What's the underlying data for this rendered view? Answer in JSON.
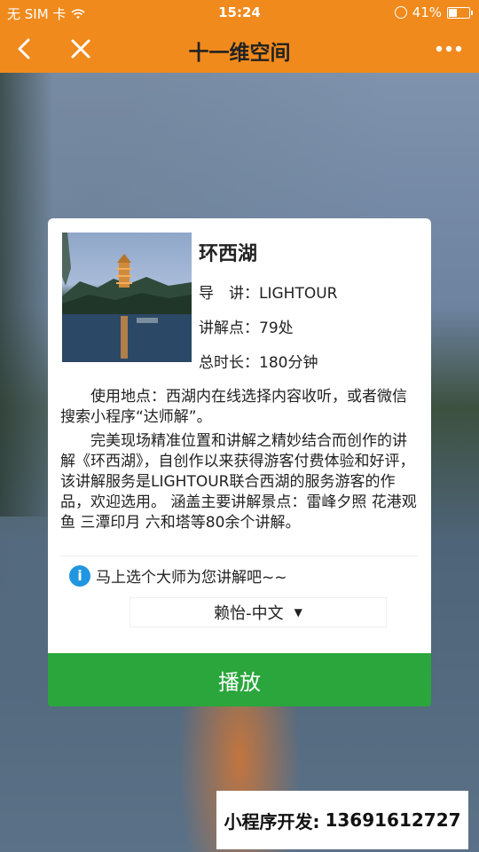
{
  "status_bar": {
    "carrier": "无 SIM 卡",
    "time": "15:24",
    "battery": "41%",
    "battery_level": 0.41
  },
  "nav": {
    "title": "十一维空间"
  },
  "card": {
    "title": "环西湖",
    "guide_label": "导　讲：",
    "guide_value": "LIGHTOUR",
    "points_label": "讲解点：",
    "points_value": "79处",
    "duration_label": "总时长：",
    "duration_value": "180分钟",
    "desc_1": "使用地点：西湖内在线选择内容收听，或者微信搜索小程序“达师解”。",
    "desc_2": "完美现场精准位置和讲解之精妙结合而创作的讲解《环西湖》，自创作以来获得游客付费体验和好评，该讲解服务是LIGHTOUR联合西湖的服务游客的作品，欢迎选用。 涵盖主要讲解景点：雷峰夕照 花港观鱼 三潭印月 六和塔等80余个讲解。",
    "hint": "马上选个大师为您讲解吧~~",
    "selector_value": "赖怡-中文"
  },
  "play_label": "播放",
  "ad": {
    "label": "小程序开发:",
    "phone": "13691612727"
  },
  "colors": {
    "nav_bg": "#f08a1c",
    "play_bg": "#2aa63c",
    "info_icon": "#2196e0"
  }
}
